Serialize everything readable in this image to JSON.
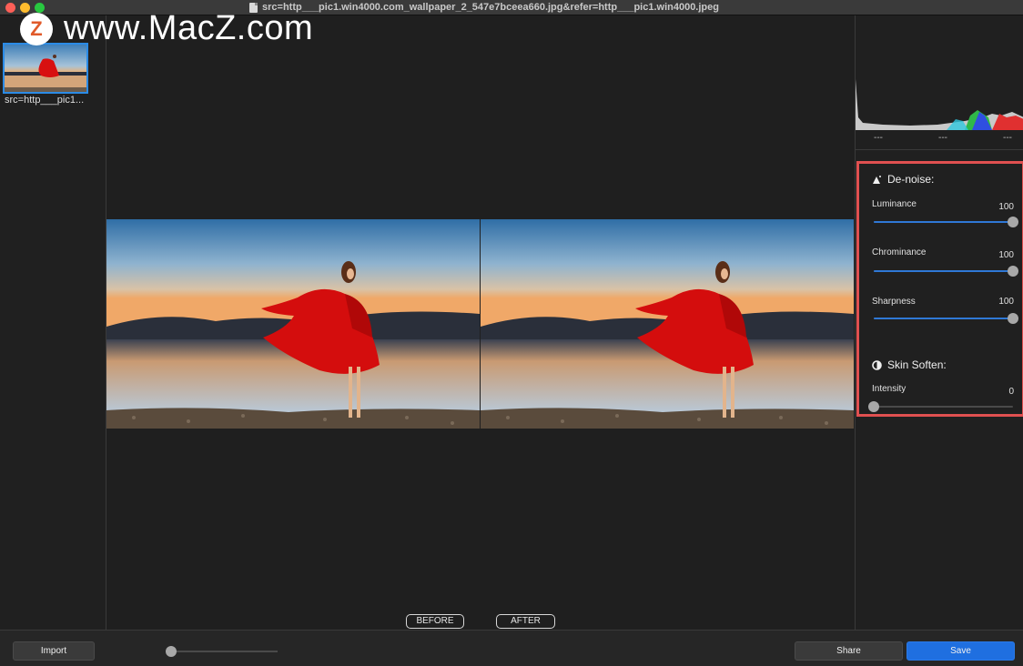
{
  "window": {
    "title": "src=http___pic1.win4000.com_wallpaper_2_547e7bceea660.jpg&refer=http___pic1.win4000.jpeg"
  },
  "watermark": {
    "logo_letter": "Z",
    "text": "www.MacZ.com"
  },
  "sidebar": {
    "items": [
      {
        "label": "src=http___pic1..."
      }
    ]
  },
  "compare": {
    "before_label": "BEFORE",
    "after_label": "AFTER"
  },
  "histogram": {
    "labels": [
      "---",
      "---",
      "---"
    ]
  },
  "adjustments": {
    "denoise": {
      "title": "De-noise:",
      "sliders": [
        {
          "label": "Luminance",
          "value": "100",
          "fraction": 1.0
        },
        {
          "label": "Chrominance",
          "value": "100",
          "fraction": 1.0
        },
        {
          "label": "Sharpness",
          "value": "100",
          "fraction": 1.0
        }
      ]
    },
    "skin": {
      "title": "Skin Soften:",
      "sliders": [
        {
          "label": "Intensity",
          "value": "0",
          "fraction": 0.0
        }
      ]
    }
  },
  "bottom": {
    "import_label": "Import",
    "share_label": "Share",
    "save_label": "Save",
    "zoom_fraction": 0.0
  },
  "colors": {
    "accent": "#2f78d6",
    "highlight": "#e05050",
    "save": "#1f6fe0"
  }
}
